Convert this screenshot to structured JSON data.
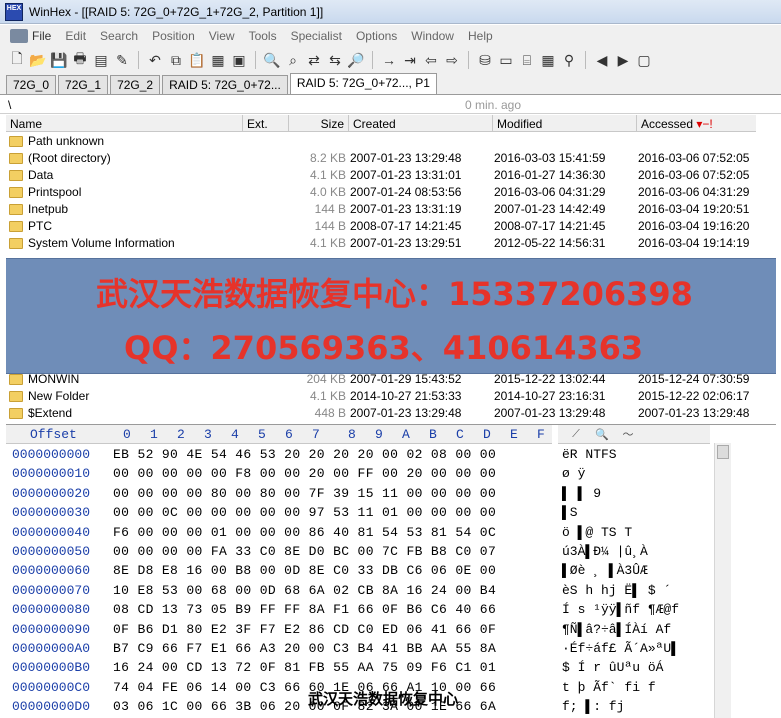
{
  "window": {
    "app_name_icon": "HEX",
    "title": "WinHex - [[RAID 5: 72G_0+72G_1+72G_2, Partition 1]]"
  },
  "menu": [
    "File",
    "Edit",
    "Search",
    "Position",
    "View",
    "Tools",
    "Specialist",
    "Options",
    "Window",
    "Help"
  ],
  "toolbar_icons": [
    "new-file-icon",
    "open-folder-icon",
    "save-icon",
    "print-icon",
    "properties-icon",
    "open-icon",
    "undo-icon",
    "copy-icon",
    "paste-icon",
    "clipboard-icon",
    "copy-block-icon",
    "find-icon",
    "find-hex-icon",
    "replace-icon",
    "replace-hex-icon",
    "find-text-icon",
    "goto-arrow-icon",
    "goto-offset-icon",
    "back-arrow-icon",
    "forward-arrow-icon",
    "disk-icon",
    "ram-icon",
    "folder-tree-icon",
    "calculator-icon",
    "search-magnifier-icon",
    "prev-icon",
    "next-icon",
    "page-icon"
  ],
  "tabs": [
    "72G_0",
    "72G_1",
    "72G_2",
    "RAID 5: 72G_0+72...",
    "RAID 5: 72G_0+72..., P1"
  ],
  "pathbar": {
    "path": "\\",
    "time": "0 min. ago"
  },
  "file_columns": {
    "name": "Name",
    "ext": "Ext.",
    "size": "Size",
    "created": "Created",
    "modified": "Modified",
    "accessed": "Accessed",
    "sort_mark": "▾−!"
  },
  "files": [
    {
      "name": "Path unknown",
      "size": "",
      "created": "",
      "modified": "",
      "accessed": ""
    },
    {
      "name": "(Root directory)",
      "size": "8.2 KB",
      "created": "2007-01-23  13:29:48",
      "modified": "2016-03-03  15:41:59",
      "accessed": "2016-03-06  07:52:05"
    },
    {
      "name": "Data",
      "size": "4.1 KB",
      "created": "2007-01-23  13:31:01",
      "modified": "2016-01-27  14:36:30",
      "accessed": "2016-03-06  07:52:05"
    },
    {
      "name": "Printspool",
      "size": "4.0 KB",
      "created": "2007-01-24  08:53:56",
      "modified": "2016-03-06  04:31:29",
      "accessed": "2016-03-06  04:31:29"
    },
    {
      "name": "Inetpub",
      "size": "144 B",
      "created": "2007-01-23  13:31:19",
      "modified": "2007-01-23  14:42:49",
      "accessed": "2016-03-04  19:20:51"
    },
    {
      "name": "PTC",
      "size": "144 B",
      "created": "2008-07-17  14:21:45",
      "modified": "2008-07-17  14:21:45",
      "accessed": "2016-03-04  19:16:20"
    },
    {
      "name": "System Volume Information",
      "size": "4.1 KB",
      "created": "2007-01-23  13:29:51",
      "modified": "2012-05-22  14:56:31",
      "accessed": "2016-03-04  19:14:19"
    },
    {
      "name": "MONWIN",
      "size": "204 KB",
      "created": "2007-01-29  15:43:52",
      "modified": "2015-12-22  13:02:44",
      "accessed": "2015-12-24  07:30:59"
    },
    {
      "name": "New Folder",
      "size": "4.1 KB",
      "created": "2014-10-27  21:53:33",
      "modified": "2014-10-27  23:16:31",
      "accessed": "2015-12-22  02:06:17"
    },
    {
      "name": "$Extend",
      "size": "448 B",
      "created": "2007-01-23  13:29:48",
      "modified": "2007-01-23  13:29:48",
      "accessed": "2007-01-23  13:29:48"
    }
  ],
  "overlay": {
    "line1": "武汉天浩数据恢复中心：15337206398",
    "line2": "QQ：270569363、410614363"
  },
  "hex_header": {
    "offset": "Offset",
    "columns": [
      "0",
      "1",
      "2",
      "3",
      "4",
      "5",
      "6",
      "7",
      "8",
      "9",
      "A",
      "B",
      "C",
      "D",
      "E",
      "F"
    ]
  },
  "hex_rows": [
    {
      "offset": "0000000000",
      "bytes": "EB 52 90 4E 54 46 53 20  20 20 20 00 02 08 00 00",
      "text": "ëR NTFS"
    },
    {
      "offset": "0000000010",
      "bytes": "00 00 00 00 00 F8 00 00  20 00 FF 00 20 00 00 00",
      "text": "     ø    ÿ"
    },
    {
      "offset": "0000000020",
      "bytes": "00 00 00 00 80 00 80 00  7F 39 15 11 00 00 00 00",
      "text": "    ▌ ▌    9"
    },
    {
      "offset": "0000000030",
      "bytes": "00 00 0C 00 00 00 00 00  97 53 11 01 00 00 00 00",
      "text": "          ▌S"
    },
    {
      "offset": "0000000040",
      "bytes": "F6 00 00 00 01 00 00 00  86 40 81 54 53 81 54 0C",
      "text": "ö         ▌@ TS T"
    },
    {
      "offset": "0000000050",
      "bytes": "00 00 00 00 FA 33 C0 8E  D0 BC 00 7C FB B8 C0 07",
      "text": "        ú3À▌Ð¼ |û¸À"
    },
    {
      "offset": "0000000060",
      "bytes": "8E D8 E8 16 00 B8 00 0D  8E C0 33 DB C6 06 0E 00",
      "text": "▌Øè ¸  ▌À3ÛÆ"
    },
    {
      "offset": "0000000070",
      "bytes": "10 E8 53 00 68 00 0D 68  6A 02 CB 8A 16 24 00 B4",
      "text": " èS h  hj Ë▌ $ ´"
    },
    {
      "offset": "0000000080",
      "bytes": "08 CD 13 73 05 B9 FF FF  8A F1 66 0F B6 C6 40 66",
      "text": " Í s ¹ÿÿ▌ñf ¶Æ@f"
    },
    {
      "offset": "0000000090",
      "bytes": "0F B6 D1 80 E2 3F F7 E2  86 CD C0 ED 06 41 66 0F",
      "text": " ¶Ñ▌â?÷â▌ÍÀí Af"
    },
    {
      "offset": "00000000A0",
      "bytes": "B7 C9 66 F7 E1 66 A3 20  00 C3 B4 41 BB AA 55 8A",
      "text": "·Éf÷áf£  Ã´A»ªU▌"
    },
    {
      "offset": "00000000B0",
      "bytes": "16 24 00 CD 13 72 0F 81  FB 55 AA 75 09 F6 C1 01",
      "text": " $ Í r  ûUªu öÁ"
    },
    {
      "offset": "00000000C0",
      "bytes": "74 04 FE 06 14 00 C3 66  60 1E 06 66 A1 10 00 66",
      "text": "t þ   Ãf` fi  f"
    },
    {
      "offset": "00000000D0",
      "bytes": "03 06 1C 00 66 3B 06 20  00 0F 82 3A 00 1E 66 6A",
      "text": "   f;     ▌:  fj"
    }
  ],
  "watermark": "武汉天浩数据恢复中心"
}
